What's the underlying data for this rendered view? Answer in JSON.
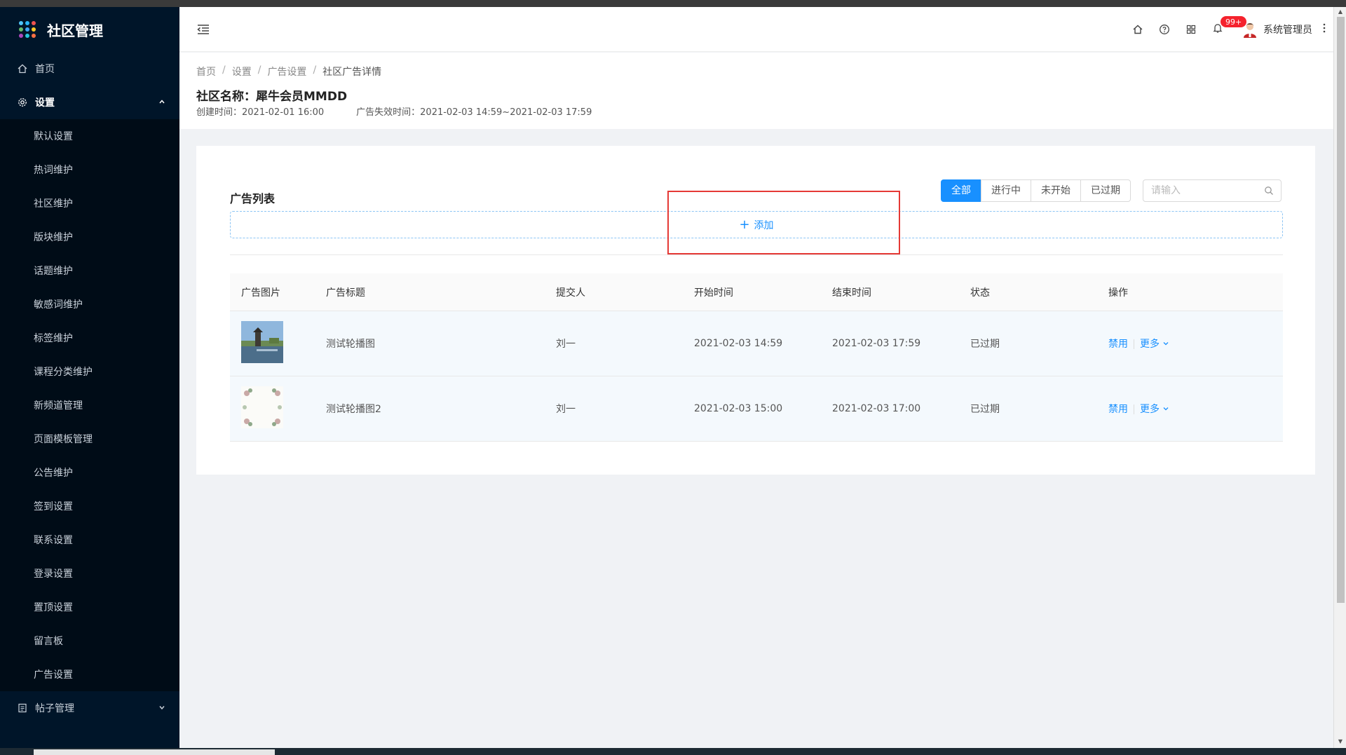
{
  "app": {
    "title": "社区管理"
  },
  "sidebar": {
    "home": "首页",
    "settings": "设置",
    "settings_items": [
      "默认设置",
      "热词维护",
      "社区维护",
      "版块维护",
      "话题维护",
      "敏感词维护",
      "标签维护",
      "课程分类维护",
      "新频道管理",
      "页面模板管理",
      "公告维护",
      "签到设置",
      "联系设置",
      "登录设置",
      "置顶设置",
      "留言板",
      "广告设置"
    ],
    "posts": "帖子管理"
  },
  "header": {
    "notification_count": "99+",
    "user_name": "系统管理员"
  },
  "breadcrumb": [
    "首页",
    "设置",
    "广告设置",
    "社区广告详情"
  ],
  "page_header": {
    "title": "社区名称：犀牛会员MMDD",
    "created": "创建时间：2021-02-01 16:00",
    "expire": "广告失效时间：2021-02-03 14:59~2021-02-03 17:59"
  },
  "card": {
    "title": "广告列表",
    "filters": [
      "全部",
      "进行中",
      "未开始",
      "已过期"
    ],
    "search_placeholder": "请输入",
    "add_label": "添加"
  },
  "table": {
    "headers": [
      "广告图片",
      "广告标题",
      "提交人",
      "开始时间",
      "结束时间",
      "状态",
      "操作"
    ],
    "rows": [
      {
        "title": "测试轮播图",
        "submitter": "刘一",
        "start": "2021-02-03 14:59",
        "end": "2021-02-03 17:59",
        "status": "已过期",
        "disable": "禁用",
        "more": "更多"
      },
      {
        "title": "测试轮播图2",
        "submitter": "刘一",
        "start": "2021-02-03 15:00",
        "end": "2021-02-03 17:00",
        "status": "已过期",
        "disable": "禁用",
        "more": "更多"
      }
    ]
  },
  "colors": {
    "primary": "#1890ff",
    "sidebar_bg": "#001529",
    "badge": "#f5222d",
    "highlight_box": "#e53935"
  },
  "icons": [
    "apps-grid-icon",
    "home-icon",
    "gear-icon",
    "list-icon",
    "menu-fold-icon",
    "help-icon",
    "fullscreen-icon",
    "bell-icon",
    "search-icon",
    "plus-icon",
    "chevron-down-icon",
    "chevron-up-icon"
  ]
}
